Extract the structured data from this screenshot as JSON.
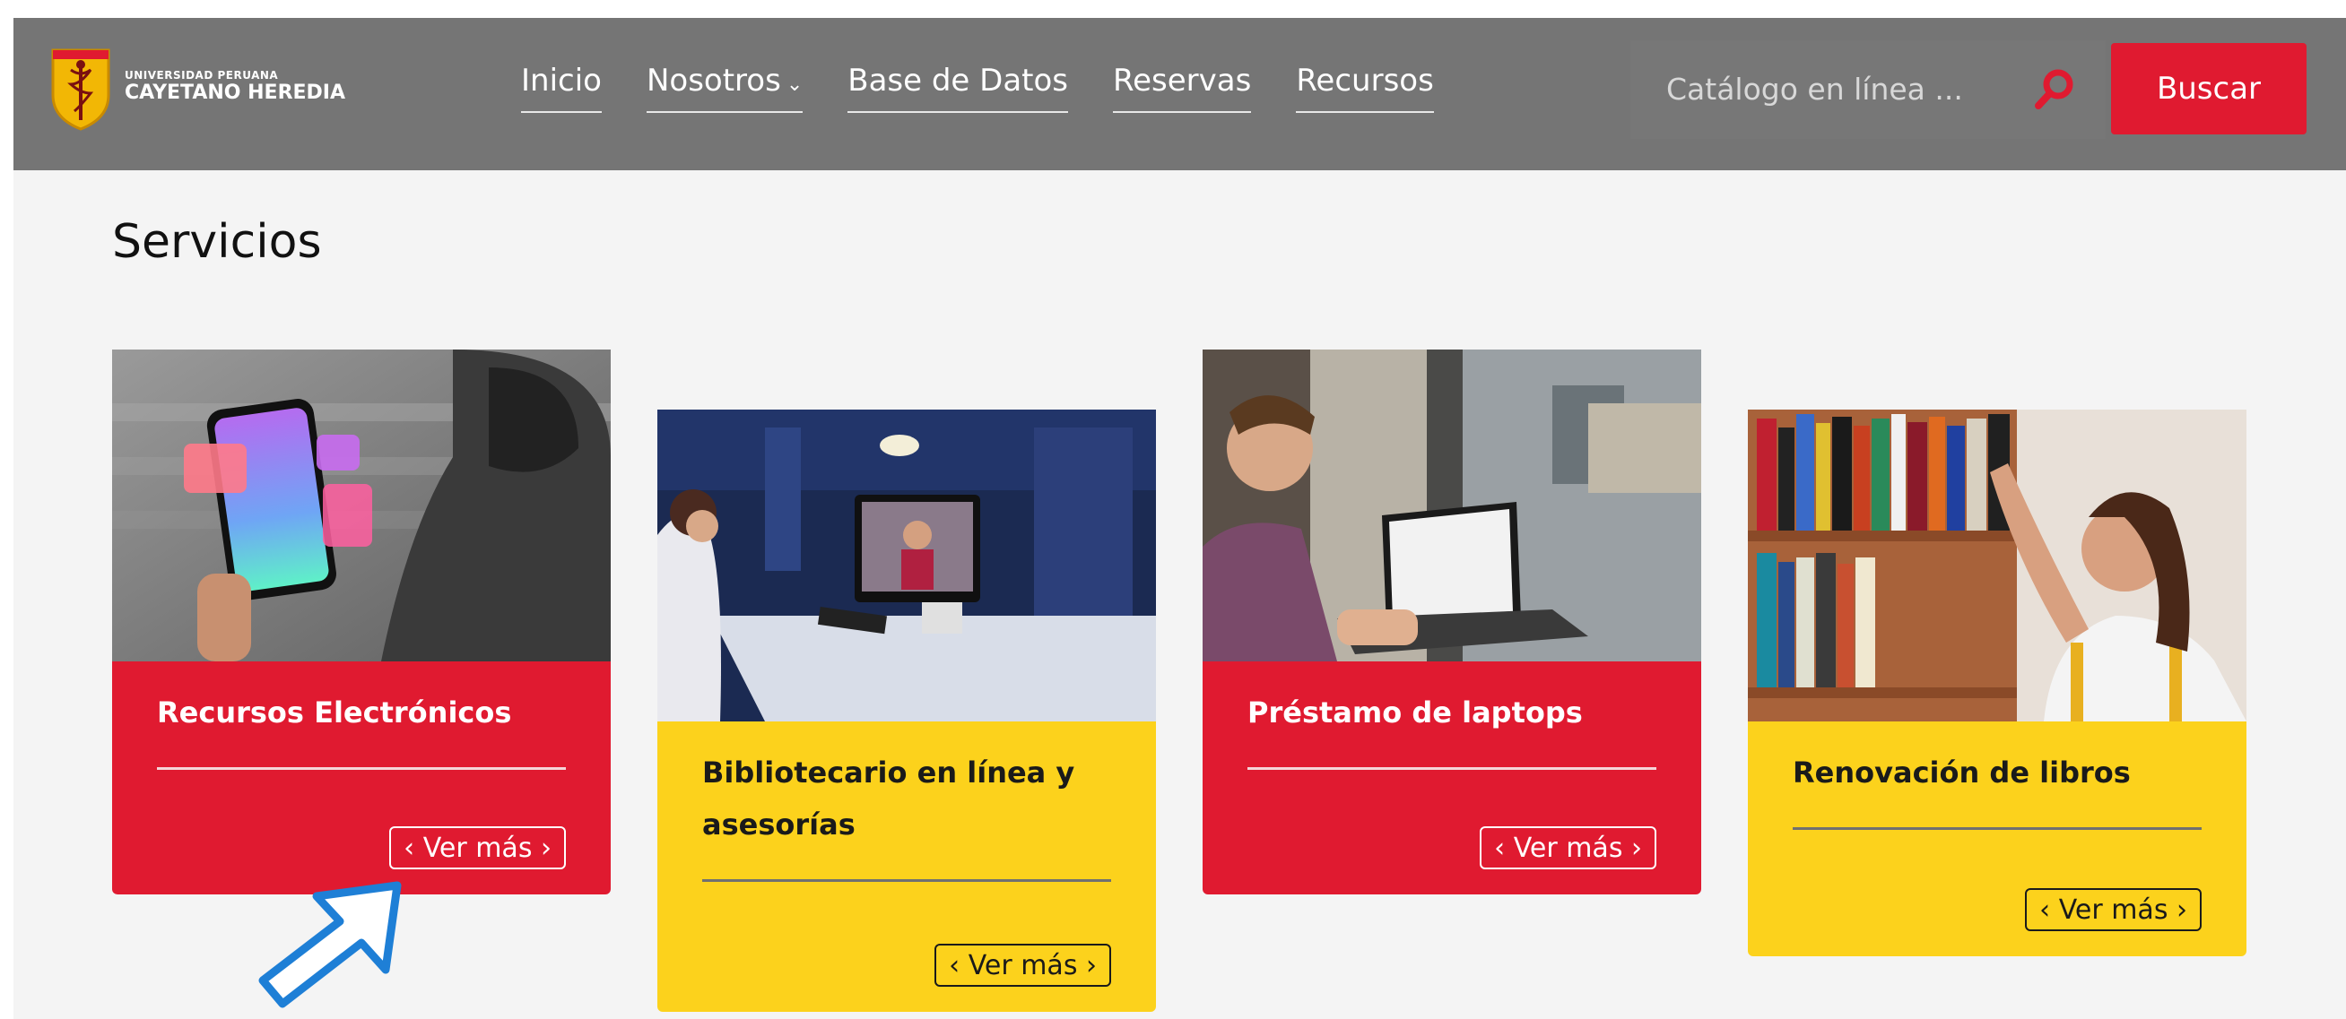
{
  "header": {
    "logo": {
      "line1": "UNIVERSIDAD PERUANA",
      "line2": "CAYETANO HEREDIA"
    },
    "nav": [
      {
        "label": "Inicio"
      },
      {
        "label": "Nosotros",
        "has_dropdown": true
      },
      {
        "label": "Base de Datos"
      },
      {
        "label": "Reservas"
      },
      {
        "label": "Recursos"
      }
    ],
    "search": {
      "placeholder": "Catálogo en línea ...",
      "icon": "search-icon",
      "button_label": "Buscar"
    }
  },
  "section": {
    "title": "Servicios"
  },
  "cards": [
    {
      "title": "Recursos Electrónicos",
      "button_label": "Ver más",
      "color": "#e01a30"
    },
    {
      "title": "Bibliotecario en línea y asesorías",
      "button_label": "Ver más",
      "color": "#fcd21c"
    },
    {
      "title": "Préstamo de laptops",
      "button_label": "Ver más",
      "color": "#e01a30"
    },
    {
      "title": "Renovación de libros",
      "button_label": "Ver más",
      "color": "#fcd21c"
    }
  ],
  "colors": {
    "accent_red": "#e01a30",
    "accent_yellow": "#fcd21c",
    "header_gray": "#757575",
    "arrow_blue": "#1e7fd6"
  }
}
